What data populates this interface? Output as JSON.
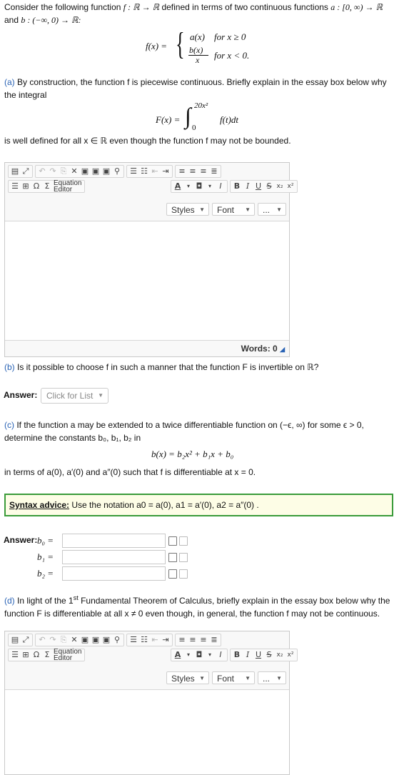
{
  "intro": {
    "text_start": "Consider the following function ",
    "fn_signature": "f : ℝ → ℝ",
    "text_mid": " defined in terms of two continuous functions ",
    "a_signature": "a : [0, ∞) → ℝ",
    "and_word": "and ",
    "b_signature": "b : (−∞, 0) → ℝ:"
  },
  "definition": {
    "lhs": "f(x) =",
    "case1_expr": "a(x)",
    "case1_cond": "for x ≥ 0",
    "case2_num": "b(x)",
    "case2_den": "x",
    "case2_cond": "for x < 0."
  },
  "part_a": {
    "label": "(a)",
    "text": " By construction, the function f is piecewise continuous. Briefly explain in the essay box below why the integral",
    "integral_lhs": "F(x) =",
    "upper_limit": "20x²",
    "lower_limit": "0",
    "integrand": "f(t)dt",
    "text_after": "is well defined for all x ∈ ℝ even though the function f may not be bounded."
  },
  "editor": {
    "equation_label": "Equation Editor",
    "styles_label": "Styles",
    "font_label": "Font",
    "more_label": "...",
    "word_count": "Words: 0"
  },
  "part_b": {
    "label": "(b)",
    "text": " Is it possible to choose f in such a manner that the function F is invertible on ℝ?",
    "answer_label": "Answer:",
    "select_placeholder": "Click for List"
  },
  "part_c": {
    "label": "(c)",
    "text": " If the function a may be extended to a twice differentiable function on (−ϵ, ∞) for some ϵ > 0, determine the constants b₀, b₁, b₂ in",
    "formula": "b(x) = b₂x² + b₁x + b₀",
    "text_after": "in terms of a(0), a′(0) and a″(0) such that f is differentiable at x = 0.",
    "syntax_title": "Syntax advice:",
    "syntax_text": " Use the notation a0 = a(0), a1 = a′(0), a2 = a″(0) .",
    "answer_label": "Answer:",
    "var_b0": "b₀ =",
    "var_b1": "b₁ =",
    "var_b2": "b₂ ="
  },
  "part_d": {
    "label": "(d)",
    "text_start": " In light of the 1",
    "superscript": "st",
    "text_end": " Fundamental Theorem of Calculus, briefly explain in the essay box below why the function F is differentiable at all x ≠ 0 even though, in general, the function f may not be continuous."
  },
  "colors": {
    "question_label": "#2a63b5",
    "syntax_border": "#3a9b3a",
    "syntax_bg": "#fdfde6"
  }
}
